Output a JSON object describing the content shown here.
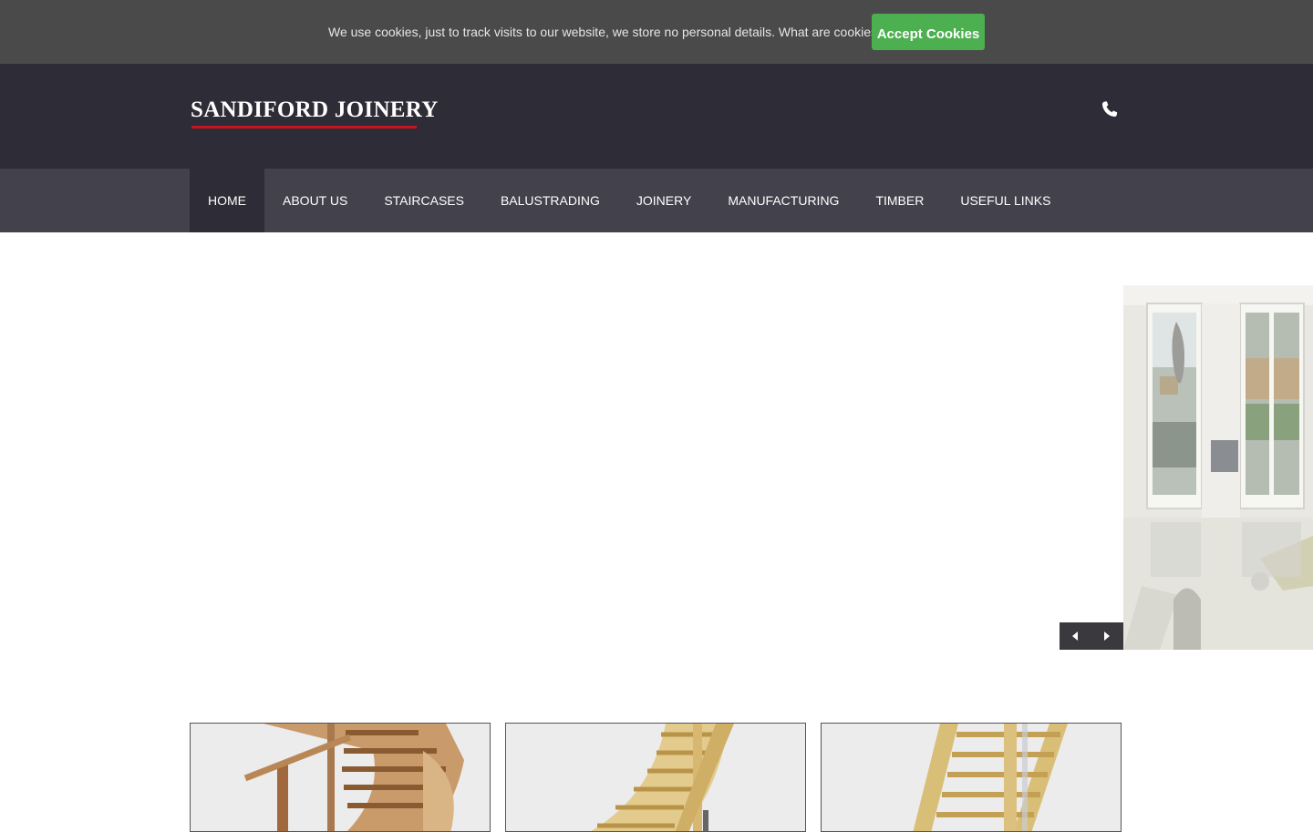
{
  "cookie_bar": {
    "message": "We use cookies, just to track visits to our website, we store no personal details.",
    "link": "What are cookies?",
    "accept_button": "Accept Cookies"
  },
  "header": {
    "logo": "SANDIFORD JOINERY",
    "phone_icon": "phone-icon"
  },
  "nav": {
    "items": [
      {
        "label": "HOME",
        "active": true
      },
      {
        "label": "ABOUT US"
      },
      {
        "label": "STAIRCASES"
      },
      {
        "label": "BALUSTRADING"
      },
      {
        "label": "JOINERY"
      },
      {
        "label": "MANUFACTURING"
      },
      {
        "label": "TIMBER"
      },
      {
        "label": "USEFUL LINKS"
      }
    ]
  },
  "slider": {
    "prev_icon": "caret-left-icon",
    "next_icon": "caret-right-icon"
  },
  "colors": {
    "cookie_bar": "#4a4a4a",
    "accept_button": "#4caf50",
    "header": "#2e2c36",
    "nav": "#43414c",
    "logo_underline": "#c8141e"
  }
}
